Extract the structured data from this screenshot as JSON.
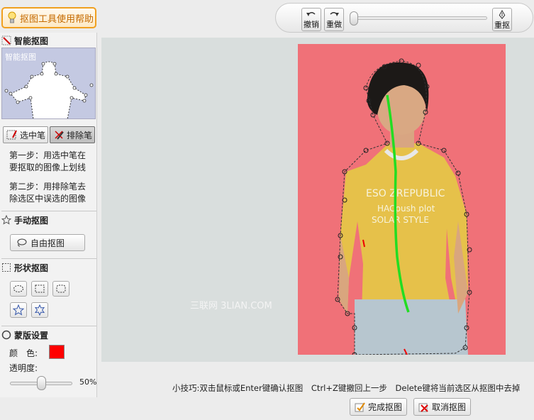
{
  "header": {
    "help_label": "抠图工具使用帮助"
  },
  "toolbar": {
    "undo_label": "撤销",
    "redo_label": "重做",
    "reset_label": "重抠"
  },
  "sidebar": {
    "smart": {
      "title": "智能抠图",
      "preview_label": "智能抠图",
      "select_pen": "选中笔",
      "exclude_pen": "排除笔",
      "step1": "第一步：用选中笔在要抠取的图像上划线",
      "step2": "第二步：用排除笔去除选区中误选的图像"
    },
    "manual": {
      "title": "手动抠图",
      "free_label": "自由抠图"
    },
    "shape": {
      "title": "形状抠图",
      "shapes": [
        "ellipse-icon",
        "rect-icon",
        "rounded-rect-icon",
        "star-icon",
        "star6-icon"
      ]
    },
    "mask": {
      "title": "蒙版设置",
      "color_label": "颜　色:",
      "color_value": "#ff0000",
      "opacity_label": "透明度:",
      "opacity_value": "50%"
    }
  },
  "canvas": {
    "watermark": "三联网 3LIAN.COM"
  },
  "footer": {
    "tip_prefix": "小技巧:双击鼠标或Enter键确认抠图",
    "tip_undo": "Ctrl+Z键撤回上一步",
    "tip_delete": "Delete键将当前选区从抠图中去掉",
    "finish_label": "完成抠图",
    "cancel_label": "取消抠图"
  }
}
